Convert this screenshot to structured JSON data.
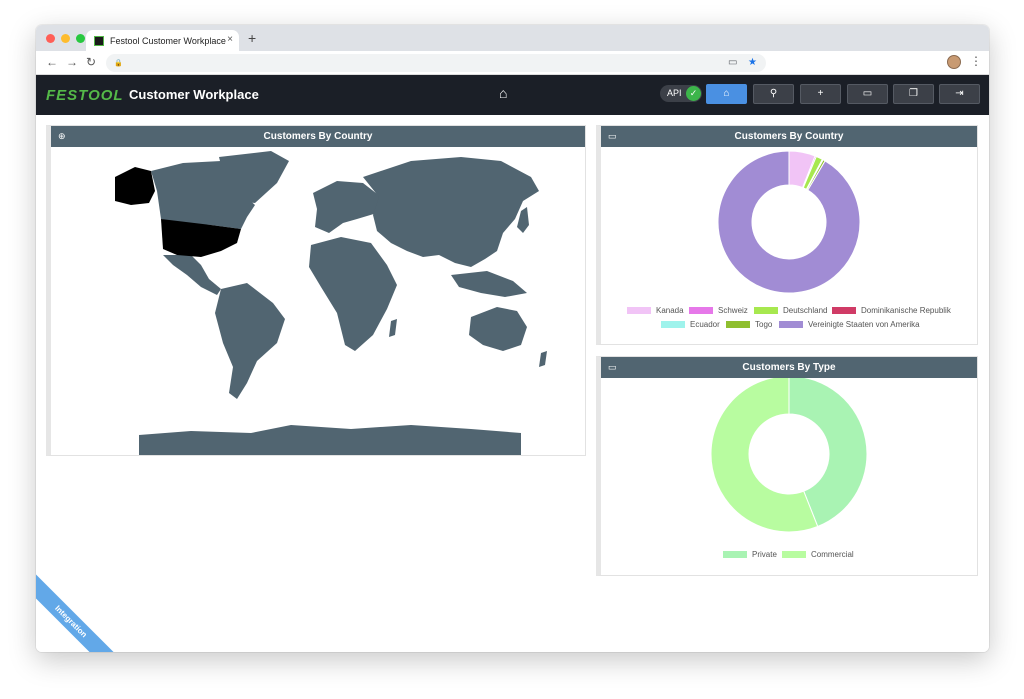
{
  "browser": {
    "tab_title": "Festool Customer Workplace",
    "tab_close": "×",
    "new_tab": "+",
    "lock": "🔒",
    "kebab": "⋮"
  },
  "app": {
    "brand": "FESTOOL",
    "title": "Customer Workplace",
    "api_label": "API",
    "api_status": "✓",
    "accent": "#54b948",
    "active_nav": "#4a90e2",
    "header_color": "#516571"
  },
  "nav_buttons": [
    {
      "icon": "home-icon",
      "glyph": "⌂"
    },
    {
      "icon": "search-icon",
      "glyph": "⚲"
    },
    {
      "icon": "plus-icon",
      "glyph": "+"
    },
    {
      "icon": "monitor-icon",
      "glyph": "▭"
    },
    {
      "icon": "cards-icon",
      "glyph": "❐"
    },
    {
      "icon": "logout-icon",
      "glyph": "⇥"
    }
  ],
  "panels": {
    "map_title": "Customers By Country",
    "country_chart_title": "Customers By Country",
    "type_chart_title": "Customers By Type"
  },
  "ribbon": "Integration",
  "chart_data": [
    {
      "type": "pie",
      "variant": "doughnut",
      "title": "Customers By Country",
      "legend_position": "bottom",
      "categories": [
        "Kanada",
        "Schweiz",
        "Deutschland",
        "Dominikanische Republik",
        "Ecuador",
        "Togo",
        "Vereinigte Staaten von Amerika"
      ],
      "values": [
        6,
        0.3,
        1.5,
        0.1,
        0.1,
        0.5,
        91.5
      ],
      "colors": [
        "#f1c4f6",
        "#e678e9",
        "#a7e84f",
        "#d03b66",
        "#9ff3ec",
        "#8fbf2f",
        "#a18cd4"
      ]
    },
    {
      "type": "pie",
      "variant": "doughnut",
      "title": "Customers By Type",
      "legend_position": "bottom",
      "categories": [
        "Private",
        "Commercial"
      ],
      "values": [
        44,
        56
      ],
      "colors": [
        "#a9f3b3",
        "#b8fca0"
      ]
    }
  ]
}
